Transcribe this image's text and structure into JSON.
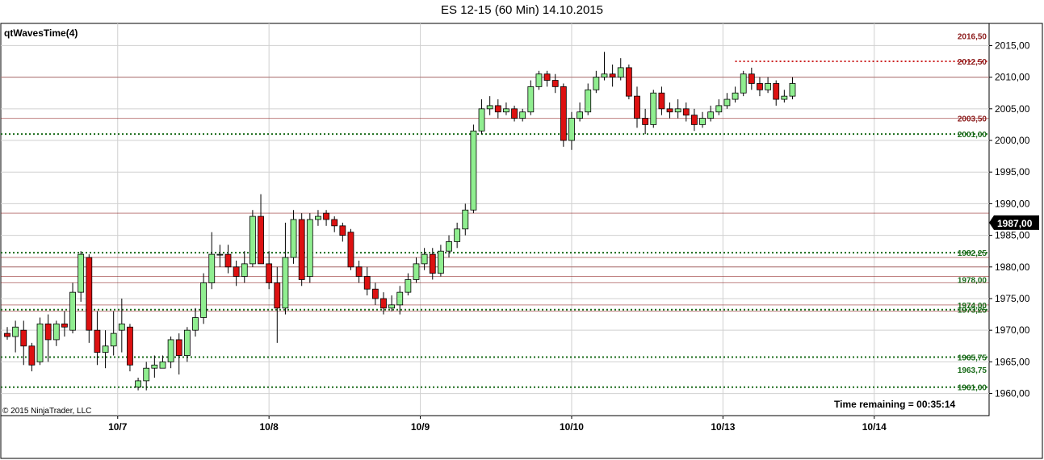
{
  "window": {
    "title": "ES 12-15 (60 Min)  14.10.2015"
  },
  "chart_data": {
    "type": "candlestick",
    "title": "ES 12-15 (60 Min)  14.10.2015",
    "indicator_label": "qtWavesTime(4)",
    "copyright": "© 2015 NinjaTrader, LLC",
    "time_remaining": "Time remaining = 00:35:14",
    "current_price_label": "1987,00",
    "current_price": 1987.0,
    "ylim": [
      1956.5,
      2018.5
    ],
    "y_ticks": [
      {
        "value": 1960,
        "label": "1960,00"
      },
      {
        "value": 1965,
        "label": "1965,00"
      },
      {
        "value": 1970,
        "label": "1970,00"
      },
      {
        "value": 1975,
        "label": "1975,00"
      },
      {
        "value": 1980,
        "label": "1980,00"
      },
      {
        "value": 1985,
        "label": "1985,00"
      },
      {
        "value": 1990,
        "label": "1990,00"
      },
      {
        "value": 1995,
        "label": "1995,00"
      },
      {
        "value": 2000,
        "label": "2000,00"
      },
      {
        "value": 2005,
        "label": "2005,00"
      },
      {
        "value": 2010,
        "label": "2010,00"
      },
      {
        "value": 2015,
        "label": "2015,00"
      }
    ],
    "x_ticks": [
      {
        "index": 13.5,
        "label": "10/7"
      },
      {
        "index": 32,
        "label": "10/8"
      },
      {
        "index": 50.5,
        "label": "10/9"
      },
      {
        "index": 69,
        "label": "10/10"
      },
      {
        "index": 87.5,
        "label": "10/13"
      },
      {
        "index": 106,
        "label": "10/14"
      }
    ],
    "candles": [
      [
        1969.5,
        1969.0,
        1970.5,
        1968.5
      ],
      [
        1969.0,
        1970.5,
        1971.5,
        1966.5
      ],
      [
        1970.0,
        1967.5,
        1971.5,
        1964.5
      ],
      [
        1967.5,
        1964.5,
        1968.0,
        1963.5
      ],
      [
        1965.0,
        1971.0,
        1972.0,
        1964.5
      ],
      [
        1971.0,
        1968.5,
        1972.5,
        1965.0
      ],
      [
        1968.5,
        1971.0,
        1971.5,
        1967.5
      ],
      [
        1971.0,
        1970.5,
        1973.0,
        1969.0
      ],
      [
        1970.0,
        1976.0,
        1977.5,
        1969.5
      ],
      [
        1976.0,
        1982.0,
        1982.5,
        1974.5
      ],
      [
        1981.5,
        1970.0,
        1982.0,
        1968.0
      ],
      [
        1970.0,
        1966.5,
        1973.0,
        1964.5
      ],
      [
        1966.5,
        1967.5,
        1970.0,
        1964.0
      ],
      [
        1967.5,
        1969.5,
        1973.0,
        1966.0
      ],
      [
        1970.0,
        1971.0,
        1975.0,
        1966.5
      ],
      [
        1970.5,
        1964.5,
        1971.0,
        1963.5
      ],
      [
        1961.0,
        1962.0,
        1962.5,
        1960.5
      ],
      [
        1962.0,
        1964.0,
        1965.0,
        1960.5
      ],
      [
        1964.0,
        1964.5,
        1966.0,
        1962.5
      ],
      [
        1964.0,
        1965.0,
        1966.0,
        1964.0
      ],
      [
        1965.0,
        1968.5,
        1969.0,
        1964.0
      ],
      [
        1968.5,
        1966.0,
        1969.5,
        1963.0
      ],
      [
        1966.0,
        1970.0,
        1970.5,
        1965.0
      ],
      [
        1970.0,
        1972.0,
        1973.5,
        1969.0
      ],
      [
        1972.0,
        1977.5,
        1979.0,
        1971.0
      ],
      [
        1977.5,
        1982.0,
        1985.5,
        1976.5
      ],
      [
        1982.0,
        1982.0,
        1983.5,
        1980.0
      ],
      [
        1982.0,
        1980.0,
        1983.5,
        1979.0
      ],
      [
        1980.0,
        1978.5,
        1981.0,
        1977.0
      ],
      [
        1978.5,
        1980.5,
        1982.5,
        1977.5
      ],
      [
        1980.5,
        1988.0,
        1989.0,
        1980.0
      ],
      [
        1988.0,
        1980.5,
        1991.5,
        1980.5
      ],
      [
        1980.5,
        1977.5,
        1982.5,
        1976.5
      ],
      [
        1977.5,
        1973.5,
        1980.0,
        1968.0
      ],
      [
        1973.5,
        1981.5,
        1987.0,
        1972.5
      ],
      [
        1981.5,
        1987.5,
        1989.0,
        1980.5
      ],
      [
        1987.5,
        1978.0,
        1988.5,
        1977.0
      ],
      [
        1978.5,
        1987.5,
        1988.5,
        1977.5
      ],
      [
        1987.5,
        1988.0,
        1989.0,
        1986.5
      ],
      [
        1988.5,
        1987.5,
        1989.0,
        1986.5
      ],
      [
        1987.5,
        1986.5,
        1988.0,
        1985.5
      ],
      [
        1986.5,
        1985.0,
        1987.0,
        1984.0
      ],
      [
        1985.5,
        1980.0,
        1986.0,
        1979.5
      ],
      [
        1980.0,
        1978.5,
        1981.0,
        1977.5
      ],
      [
        1978.5,
        1976.5,
        1980.0,
        1975.5
      ],
      [
        1976.5,
        1975.0,
        1977.5,
        1974.0
      ],
      [
        1975.0,
        1973.5,
        1976.0,
        1972.5
      ],
      [
        1973.5,
        1974.0,
        1975.5,
        1973.0
      ],
      [
        1974.0,
        1976.0,
        1977.0,
        1972.5
      ],
      [
        1976.0,
        1978.0,
        1979.0,
        1975.5
      ],
      [
        1978.0,
        1980.5,
        1981.5,
        1977.5
      ],
      [
        1980.5,
        1982.0,
        1983.0,
        1979.5
      ],
      [
        1982.0,
        1979.0,
        1983.0,
        1978.0
      ],
      [
        1979.0,
        1982.5,
        1983.5,
        1978.5
      ],
      [
        1982.5,
        1984.0,
        1985.0,
        1981.5
      ],
      [
        1984.0,
        1986.0,
        1987.0,
        1983.0
      ],
      [
        1986.0,
        1989.0,
        1990.0,
        1985.0
      ],
      [
        1989.0,
        2001.5,
        2002.5,
        1988.5
      ],
      [
        2001.5,
        2005.0,
        2006.5,
        2001.0
      ],
      [
        2005.0,
        2005.5,
        2007.0,
        2004.0
      ],
      [
        2005.5,
        2004.5,
        2006.5,
        2003.5
      ],
      [
        2004.5,
        2005.0,
        2006.0,
        2004.0
      ],
      [
        2005.0,
        2003.5,
        2005.5,
        2003.0
      ],
      [
        2003.5,
        2004.5,
        2005.0,
        2003.0
      ],
      [
        2004.5,
        2008.5,
        2009.5,
        2004.0
      ],
      [
        2008.5,
        2010.5,
        2011.0,
        2008.0
      ],
      [
        2010.5,
        2009.5,
        2011.0,
        2008.5
      ],
      [
        2009.5,
        2008.5,
        2010.5,
        2007.5
      ],
      [
        2008.5,
        2000.0,
        2009.0,
        1999.0
      ],
      [
        2000.0,
        2003.5,
        2004.5,
        1998.5
      ],
      [
        2003.5,
        2004.5,
        2006.0,
        2003.0
      ],
      [
        2004.5,
        2008.0,
        2009.0,
        2004.0
      ],
      [
        2008.0,
        2010.0,
        2011.0,
        2007.5
      ],
      [
        2010.0,
        2010.5,
        2014.0,
        2009.5
      ],
      [
        2010.5,
        2010.0,
        2012.0,
        2008.5
      ],
      [
        2010.0,
        2011.5,
        2013.0,
        2009.5
      ],
      [
        2011.5,
        2007.0,
        2012.0,
        2006.5
      ],
      [
        2007.0,
        2003.5,
        2008.5,
        2002.0
      ],
      [
        2003.5,
        2002.5,
        2005.0,
        2001.0
      ],
      [
        2002.5,
        2007.5,
        2008.0,
        2002.0
      ],
      [
        2007.5,
        2005.0,
        2008.5,
        2004.0
      ],
      [
        2005.0,
        2004.5,
        2006.0,
        2003.5
      ],
      [
        2004.5,
        2005.0,
        2006.5,
        2003.5
      ],
      [
        2005.0,
        2004.0,
        2006.0,
        2003.0
      ],
      [
        2004.0,
        2002.5,
        2005.0,
        2001.5
      ],
      [
        2002.5,
        2003.5,
        2004.5,
        2002.0
      ],
      [
        2003.5,
        2004.5,
        2005.5,
        2003.0
      ],
      [
        2004.5,
        2005.5,
        2006.5,
        2004.0
      ],
      [
        2005.5,
        2006.5,
        2007.5,
        2005.0
      ],
      [
        2006.5,
        2007.5,
        2008.5,
        2006.0
      ],
      [
        2007.5,
        2010.5,
        2011.0,
        2007.0
      ],
      [
        2010.5,
        2009.0,
        2011.5,
        2008.0
      ],
      [
        2009.0,
        2008.0,
        2010.0,
        2007.0
      ],
      [
        2008.0,
        2009.0,
        2010.0,
        2007.5
      ],
      [
        2009.0,
        2006.5,
        2009.5,
        2005.5
      ],
      [
        2006.5,
        2007.0,
        2008.0,
        2006.0
      ],
      [
        2007.0,
        2009.0,
        2010.0,
        2006.5
      ]
    ],
    "horizontal_levels_red": [
      2003.5,
      1981.5,
      1980.0,
      1978.5,
      1977.5,
      1974.0,
      1973.0,
      1988.5,
      2010.0
    ],
    "right_labels": [
      {
        "value": 2016.5,
        "label": "2016,50",
        "color": "#8b1a1a"
      },
      {
        "value": 2012.5,
        "label": "2012,50",
        "color": "#8b1a1a"
      },
      {
        "value": 2003.5,
        "label": "2003,50",
        "color": "#8b1a1a"
      },
      {
        "value": 2001.0,
        "label": "2001,00",
        "color": "#1a6b1a"
      },
      {
        "value": 1982.25,
        "label": "1982,25",
        "color": "#1a6b1a"
      },
      {
        "value": 1978.0,
        "label": "1978,00",
        "color": "#1a6b1a"
      },
      {
        "value": 1974.0,
        "label": "1974,00",
        "color": "#1a6b1a"
      },
      {
        "value": 1973.25,
        "label": "1973,25",
        "color": "#1a6b1a"
      },
      {
        "value": 1965.75,
        "label": "1965,75",
        "color": "#1a6b1a"
      },
      {
        "value": 1963.75,
        "label": "1963,75",
        "color": "#1a6b1a"
      },
      {
        "value": 1961.0,
        "label": "1961,00",
        "color": "#1a6b1a"
      }
    ],
    "green_dotted_levels": [
      1982.25,
      1973.25,
      1965.75,
      1961.0,
      2001.0
    ],
    "red_dotted_level": 2012.5,
    "grid": true,
    "colors": {
      "up": "#90ee90",
      "down": "#dd1111",
      "wick": "#000000",
      "red_line": "#8b1a1a",
      "green_line": "#1a6b1a",
      "grid": "#d0d0d0"
    }
  }
}
